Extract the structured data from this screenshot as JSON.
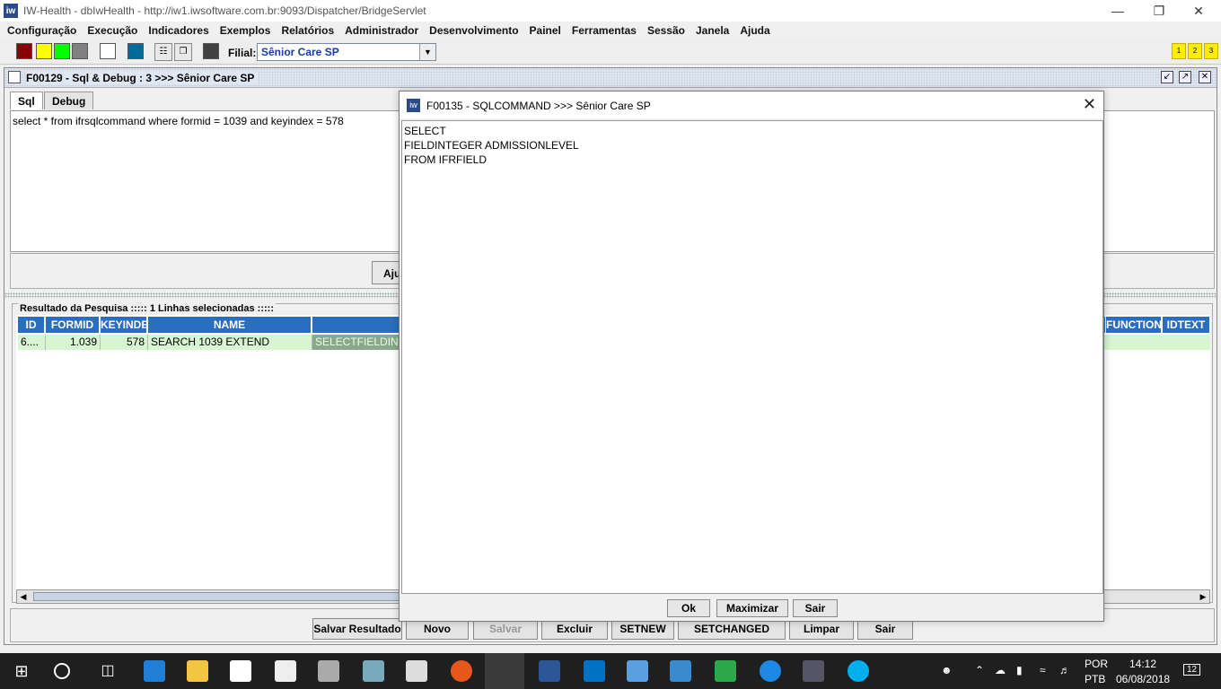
{
  "window": {
    "title": "IW-Health - dbIwHealth - http://iw1.iwsoftware.com.br:9093/Dispatcher/BridgeServlet"
  },
  "menu": [
    "Configuração",
    "Execução",
    "Indicadores",
    "Exemplos",
    "Relatórios",
    "Administrador",
    "Desenvolvimento",
    "Painel",
    "Ferramentas",
    "Sessão",
    "Janela",
    "Ajuda"
  ],
  "toolbar": {
    "filial_label": "Filial:",
    "filial_value": "Sênior Care SP",
    "num_buttons": [
      "1",
      "2",
      "3"
    ],
    "swatch_colors": [
      "#8b0000",
      "#ffff00",
      "#00ff00",
      "#808080",
      "#ffffff",
      "#006b9a",
      "#404040"
    ]
  },
  "frame": {
    "title": "F00129 - Sql & Debug : 3 >>> Sênior Care SP",
    "tabs": [
      "Sql",
      "Debug"
    ],
    "sql_text": "select * from ifrsqlcommand where formid = 1039 and keyindex = 578",
    "ajus_label": "Ajus",
    "result_title": "Resultado da Pesquisa ::::: 1 Linhas selecionadas :::::",
    "columns": [
      "ID",
      "FORMID",
      "KEYINDE",
      "NAME",
      "FUNCTION",
      "IDTEXT"
    ],
    "row": [
      "6....",
      "1.039",
      "578",
      "SEARCH 1039 EXTEND",
      "SELECTFIELDINT"
    ],
    "buttons": [
      "Salvar Resultado",
      "Novo",
      "Salvar",
      "Excluir",
      "SETNEW",
      "SETCHANGED",
      "Limpar",
      "Sair"
    ]
  },
  "dialog": {
    "title": "F00135 - SQLCOMMAND >>> Sênior Care SP",
    "lines": [
      "SELECT",
      "FIELDINTEGER ADMISSIONLEVEL",
      "FROM IFRFIELD"
    ],
    "buttons": [
      "Ok",
      "Maximizar",
      "Sair"
    ]
  },
  "taskbar": {
    "lang1": "POR",
    "lang2": "PTB",
    "time": "14:12",
    "date": "06/08/2018",
    "notifications": "12"
  }
}
